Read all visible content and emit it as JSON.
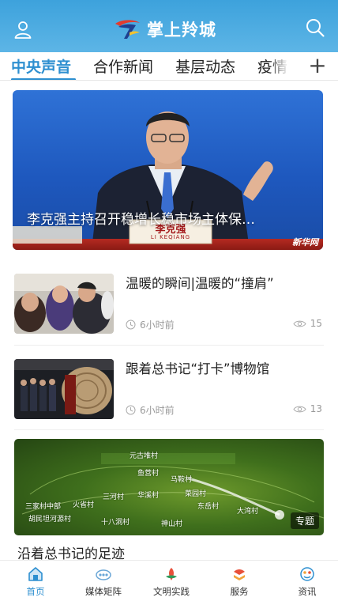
{
  "header": {
    "title": "掌上羚城"
  },
  "tabs": [
    {
      "label": "中央声音",
      "active": true
    },
    {
      "label": "合作新闻"
    },
    {
      "label": "基层动态"
    },
    {
      "label": "疫情"
    }
  ],
  "hero": {
    "caption": "李克强主持召开稳增长稳市场主体保…",
    "nameplate_cn": "李克强",
    "nameplate_en": "LI KEQIANG",
    "watermark": "新华网"
  },
  "news": [
    {
      "title": "温暖的瞬间|温暖的“撞肩”",
      "time": "6小时前",
      "views": "15"
    },
    {
      "title": "跟着总书记“打卡”博物馆",
      "time": "6小时前",
      "views": "13"
    }
  ],
  "feature": {
    "tag": "专题",
    "title": "沿着总书记的足迹",
    "map_labels": [
      "三家村中部",
      "火省村",
      "胡民坦河源村",
      "三河村",
      "十八洞村",
      "菜园村",
      "华溪村",
      "神山村",
      "大湾村",
      "东岳村",
      "元古堆村",
      "鱼营村",
      "马鞍村"
    ]
  },
  "tabbar": [
    {
      "label": "首页",
      "icon": "home-icon",
      "active": true
    },
    {
      "label": "媒体矩阵",
      "icon": "media-matrix-icon"
    },
    {
      "label": "文明实践",
      "icon": "civilization-practice-icon"
    },
    {
      "label": "服务",
      "icon": "service-icon"
    },
    {
      "label": "资讯",
      "icon": "info-icon"
    }
  ],
  "colors": {
    "accent": "#2d8fd0",
    "header": "#4aaee2"
  }
}
